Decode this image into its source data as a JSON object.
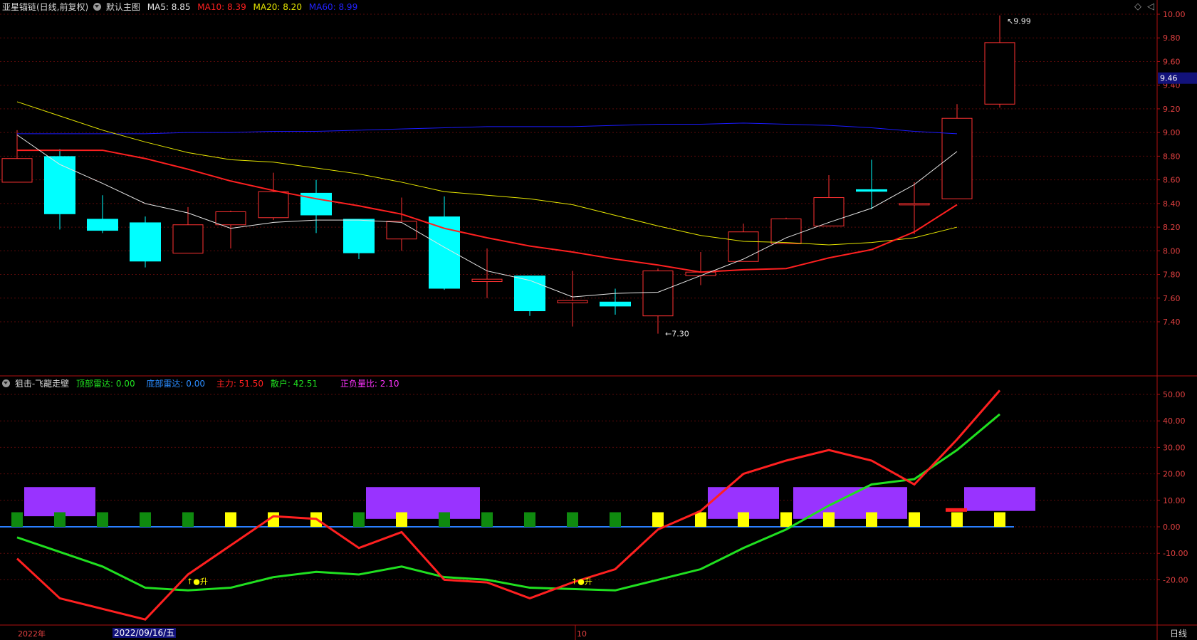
{
  "main_header": {
    "symbol": "亚星锚链(日线,前复权)",
    "template": "默认主图",
    "ma5": "MA5: 8.85",
    "ma10": "MA10: 8.39",
    "ma20": "MA20: 8.20",
    "ma60": "MA60: 8.99"
  },
  "sub_header": {
    "indicator": "狙击-飞龍走壁",
    "top_radar": "顶部雷达: 0.00",
    "bottom_radar": "底部雷达: 0.00",
    "main_force": "主力: 51.50",
    "retail": "散户: 42.51",
    "pos_neg_ratio": "正负量比: 2.10"
  },
  "colors": {
    "up": "#ff3232",
    "down": "#00ffff",
    "ma5": "#e6e6e6",
    "ma10": "#ff2020",
    "ma20": "#e6e600",
    "ma60": "#1a1aff",
    "main_force": "#ff2020",
    "retail": "#20e020",
    "purple": "#9933ff",
    "green_bar": "#0f8a0f",
    "yellow_bar": "#ffff00",
    "zero_line": "#2a7fff"
  },
  "price_axis": {
    "ticks": [
      "10.00",
      "9.80",
      "9.60",
      "9.40",
      "9.20",
      "9.00",
      "8.80",
      "8.60",
      "8.40",
      "8.20",
      "8.00",
      "7.80",
      "7.60",
      "7.40"
    ],
    "current_price": "9.46",
    "max_label": "9.99",
    "min_label": "7.30"
  },
  "sub_axis": {
    "ticks": [
      "50.00",
      "40.00",
      "30.00",
      "20.00",
      "10.00",
      "0.00",
      "-10.00",
      "-20.00"
    ]
  },
  "bottom_bar": {
    "year": "2022年",
    "cursor_date": "2022/09/16/五",
    "month": "10",
    "period": "日线"
  },
  "signal_labels": [
    "↑●升",
    "↑●升"
  ],
  "chart_data": {
    "type": "candlestick",
    "candles": [
      {
        "o": 8.58,
        "h": 9.02,
        "l": 8.58,
        "c": 8.78
      },
      {
        "o": 8.8,
        "h": 8.86,
        "l": 8.18,
        "c": 8.31
      },
      {
        "o": 8.27,
        "h": 8.47,
        "l": 8.15,
        "c": 8.17
      },
      {
        "o": 8.24,
        "h": 8.29,
        "l": 7.86,
        "c": 7.91
      },
      {
        "o": 7.98,
        "h": 8.37,
        "l": 7.98,
        "c": 8.22
      },
      {
        "o": 8.22,
        "h": 8.34,
        "l": 8.02,
        "c": 8.33
      },
      {
        "o": 8.28,
        "h": 8.66,
        "l": 8.26,
        "c": 8.5
      },
      {
        "o": 8.49,
        "h": 8.6,
        "l": 8.15,
        "c": 8.3
      },
      {
        "o": 8.27,
        "h": 8.27,
        "l": 7.93,
        "c": 7.98
      },
      {
        "o": 8.1,
        "h": 8.45,
        "l": 8.0,
        "c": 8.25
      },
      {
        "o": 8.29,
        "h": 8.46,
        "l": 7.67,
        "c": 7.68
      },
      {
        "o": 7.74,
        "h": 8.02,
        "l": 7.6,
        "c": 7.76
      },
      {
        "o": 7.79,
        "h": 7.79,
        "l": 7.45,
        "c": 7.49
      },
      {
        "o": 7.56,
        "h": 7.83,
        "l": 7.36,
        "c": 7.58
      },
      {
        "o": 7.57,
        "h": 7.68,
        "l": 7.46,
        "c": 7.53
      },
      {
        "o": 7.45,
        "h": 7.85,
        "l": 7.3,
        "c": 7.83
      },
      {
        "o": 7.79,
        "h": 7.99,
        "l": 7.71,
        "c": 7.82
      },
      {
        "o": 7.91,
        "h": 8.23,
        "l": 7.91,
        "c": 8.16
      },
      {
        "o": 8.06,
        "h": 8.28,
        "l": 8.06,
        "c": 8.27
      },
      {
        "o": 8.21,
        "h": 8.64,
        "l": 8.21,
        "c": 8.45
      },
      {
        "o": 8.52,
        "h": 8.77,
        "l": 8.35,
        "c": 8.5
      },
      {
        "o": 8.4,
        "h": 8.58,
        "l": 8.14,
        "c": 8.4
      },
      {
        "o": 8.44,
        "h": 9.24,
        "l": 8.44,
        "c": 9.12
      },
      {
        "o": 9.24,
        "h": 9.99,
        "l": 9.21,
        "c": 9.76
      }
    ],
    "ma5": [
      8.98,
      8.73,
      8.57,
      8.4,
      8.32,
      8.19,
      8.24,
      8.26,
      8.26,
      8.24,
      8.03,
      7.83,
      7.75,
      7.61,
      7.64,
      7.65,
      7.79,
      7.93,
      8.11,
      8.24,
      8.36,
      8.56,
      8.84
    ],
    "ma10": [
      8.85,
      8.85,
      8.85,
      8.78,
      8.69,
      8.59,
      8.51,
      8.44,
      8.38,
      8.31,
      8.19,
      8.11,
      8.04,
      7.99,
      7.93,
      7.88,
      7.82,
      7.84,
      7.85,
      7.94,
      8.01,
      8.16,
      8.39
    ],
    "ma20": [
      9.26,
      9.14,
      9.02,
      8.92,
      8.83,
      8.77,
      8.75,
      8.7,
      8.65,
      8.58,
      8.5,
      8.47,
      8.44,
      8.39,
      8.3,
      8.21,
      8.13,
      8.08,
      8.07,
      8.05,
      8.07,
      8.11,
      8.2
    ],
    "ma60": [
      8.99,
      8.99,
      8.99,
      8.99,
      9.0,
      9.0,
      9.01,
      9.01,
      9.02,
      9.03,
      9.04,
      9.05,
      9.05,
      9.05,
      9.06,
      9.07,
      9.07,
      9.08,
      9.07,
      9.06,
      9.04,
      9.01,
      8.99
    ],
    "main_force": [
      -12,
      -27,
      -31,
      -35,
      -18,
      -7,
      4,
      3,
      -8,
      -2,
      -20,
      -21,
      -27,
      -21,
      -16,
      -1,
      6,
      20,
      25,
      29,
      25,
      16,
      33,
      51.5
    ],
    "retail": [
      -4,
      -9.5,
      -15,
      -23,
      -24,
      -23,
      -19,
      -17,
      -18,
      -15,
      -19,
      -20,
      -23,
      -23.5,
      -24,
      -20,
      -16,
      -8,
      -1,
      8,
      16,
      18,
      29,
      42.51
    ],
    "bars": [
      "g",
      "g",
      "g",
      "g",
      "g",
      "y",
      "y",
      "y",
      "g",
      "y",
      "g",
      "g",
      "g",
      "g",
      "g",
      "y",
      "y",
      "y",
      "y",
      "y",
      "y",
      "y",
      "y",
      "y"
    ],
    "purple_boxes": [
      {
        "from": 0,
        "to": 1,
        "low": 4,
        "high": 15
      },
      {
        "from": 8,
        "to": 10,
        "low": 3,
        "high": 15
      },
      {
        "from": 16,
        "to": 17,
        "low": 3,
        "high": 15
      },
      {
        "from": 18,
        "to": 20,
        "low": 3,
        "high": 15
      },
      {
        "from": 22,
        "to": 23,
        "low": 6,
        "high": 15
      }
    ],
    "red_marker": {
      "index": 22,
      "value": 6.5
    },
    "price_ylim": [
      7.2,
      10.05
    ],
    "sub_ylim": [
      -38,
      57
    ]
  }
}
